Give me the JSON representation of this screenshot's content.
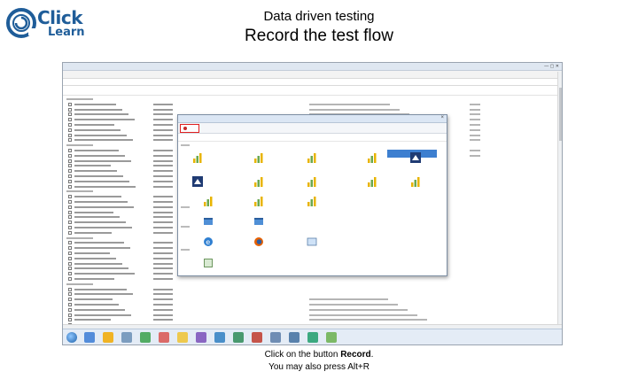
{
  "logo": {
    "word1": "Click",
    "word2": "Learn",
    "ring_color": "#1f5d99"
  },
  "slide": {
    "title": "Data driven testing",
    "subtitle": "Record the test flow",
    "caption_prefix": "Click on the button ",
    "caption_strong": "Record",
    "caption_suffix": ".",
    "caption_line2": "You may also press Alt+R"
  },
  "colors": {
    "record_highlight": "#e02020",
    "selected_item": "#3d7fd0",
    "brand": "#1f5d99"
  },
  "icons": {
    "record": "record-icon",
    "chart": "chart-icon",
    "bird": "bird-icon",
    "app": "app-icon",
    "browser_ie": "ie-browser-icon",
    "browser_firefox": "firefox-browser-icon",
    "window": "window-icon",
    "test": "test-icon"
  }
}
